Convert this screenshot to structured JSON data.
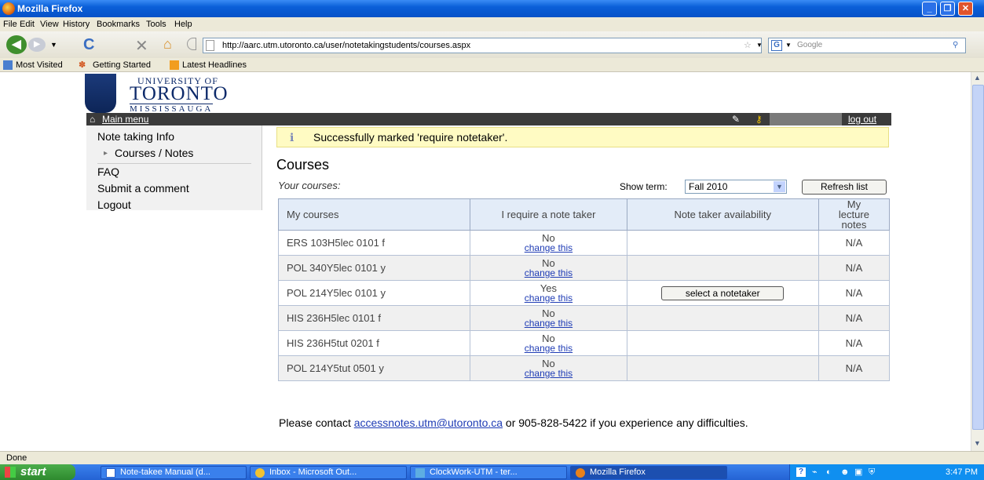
{
  "window": {
    "title": "Mozilla Firefox"
  },
  "menubar": [
    "File",
    "Edit",
    "View",
    "History",
    "Bookmarks",
    "Tools",
    "Help"
  ],
  "url": "http://aarc.utm.utoronto.ca/user/notetakingstudents/courses.aspx",
  "search_placeholder": "Google",
  "bookmarks": [
    "Most Visited",
    "Getting Started",
    "Latest Headlines"
  ],
  "logo": {
    "line1": "UNIVERSITY OF",
    "line2": "TORONTO",
    "line3": "MISSISSAUGA"
  },
  "mainmenu": {
    "label": "Main menu",
    "logout": "log out"
  },
  "sidenav": {
    "info": "Note taking Info",
    "courses": "Courses / Notes",
    "faq": "FAQ",
    "submit": "Submit a comment",
    "logout": "Logout"
  },
  "message": "Successfully marked 'require notetaker'.",
  "heading": "Courses",
  "your_courses": "Your courses:",
  "term": {
    "label": "Show term:",
    "value": "Fall 2010"
  },
  "refresh": "Refresh list",
  "table": {
    "headers": [
      "My courses",
      "I require a note taker",
      "Note taker availability",
      "My lecture notes"
    ],
    "change_label": "change this",
    "select_label": "select a notetaker",
    "rows": [
      {
        "course": "ERS 103H5lec 0101 f",
        "require": "No",
        "notes": "N/A"
      },
      {
        "course": "POL 340Y5lec 0101 y",
        "require": "No",
        "notes": "N/A"
      },
      {
        "course": "POL 214Y5lec 0101 y",
        "require": "Yes",
        "notes": "N/A"
      },
      {
        "course": "HIS 236H5lec 0101 f",
        "require": "No",
        "notes": "N/A"
      },
      {
        "course": "HIS 236H5tut 0201 f",
        "require": "No",
        "notes": "N/A"
      },
      {
        "course": "POL 214Y5tut 0501 y",
        "require": "No",
        "notes": "N/A"
      }
    ]
  },
  "contact": {
    "pre": "Please contact ",
    "email": "accessnotes.utm@utoronto.ca",
    "post": " or 905-828-5422 if you experience any difficulties."
  },
  "status": "Done",
  "taskbar": {
    "start": "start",
    "tasks": [
      "Note-takee Manual (d...",
      "Inbox - Microsoft Out...",
      "ClockWork-UTM - ter...",
      "Mozilla Firefox"
    ],
    "clock": "3:47 PM"
  }
}
